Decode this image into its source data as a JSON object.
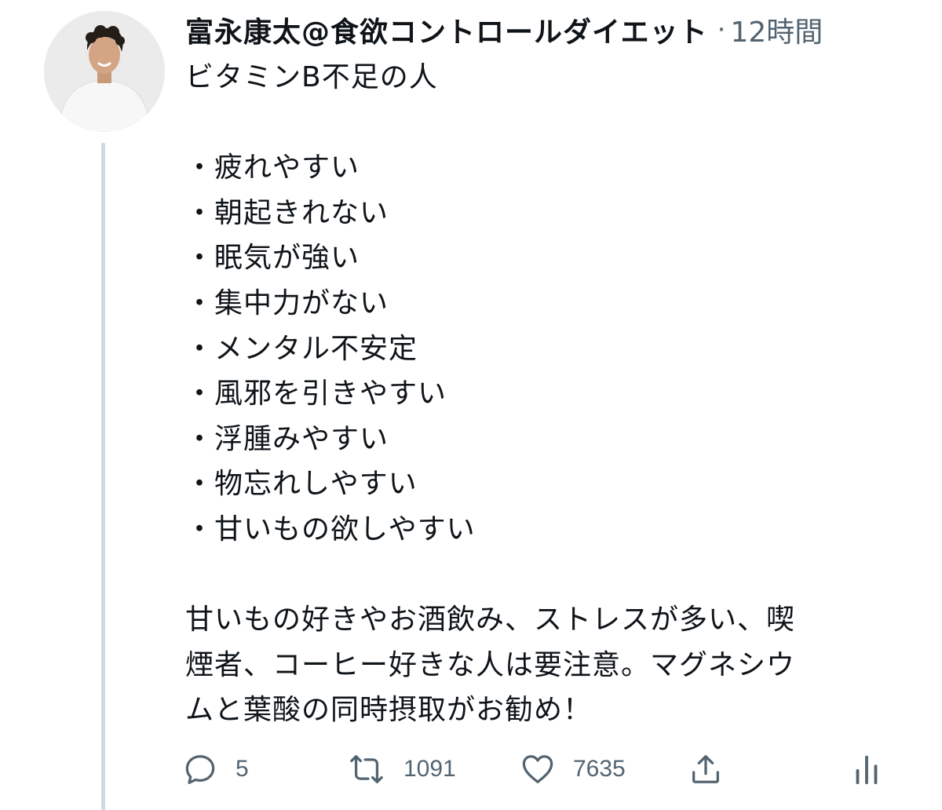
{
  "tweet": {
    "display_name": "富永康太@食欲コントロールダイエット",
    "separator": "·",
    "time": "12時間",
    "text": "ビタミンB不足の人\n\n・疲れやすい\n・朝起きれない\n・眠気が強い\n・集中力がない\n・メンタル不安定\n・風邪を引きやすい\n・浮腫みやすい\n・物忘れしやすい\n・甘いもの欲しやすい\n\n甘いもの好きやお酒飲み、ストレスが多い、喫\n煙者、コーヒー好きな人は要注意。マグネシウ\nムと葉酸の同時摂取がお勧め！"
  },
  "actions": {
    "reply_count": "5",
    "retweet_count": "1091",
    "like_count": "7635"
  },
  "colors": {
    "text": "#0f1419",
    "secondary": "#536471",
    "thread_line": "#cfd9de"
  },
  "icons": [
    "avatar-photo",
    "reply-icon",
    "retweet-icon",
    "like-icon",
    "share-icon",
    "analytics-icon"
  ]
}
